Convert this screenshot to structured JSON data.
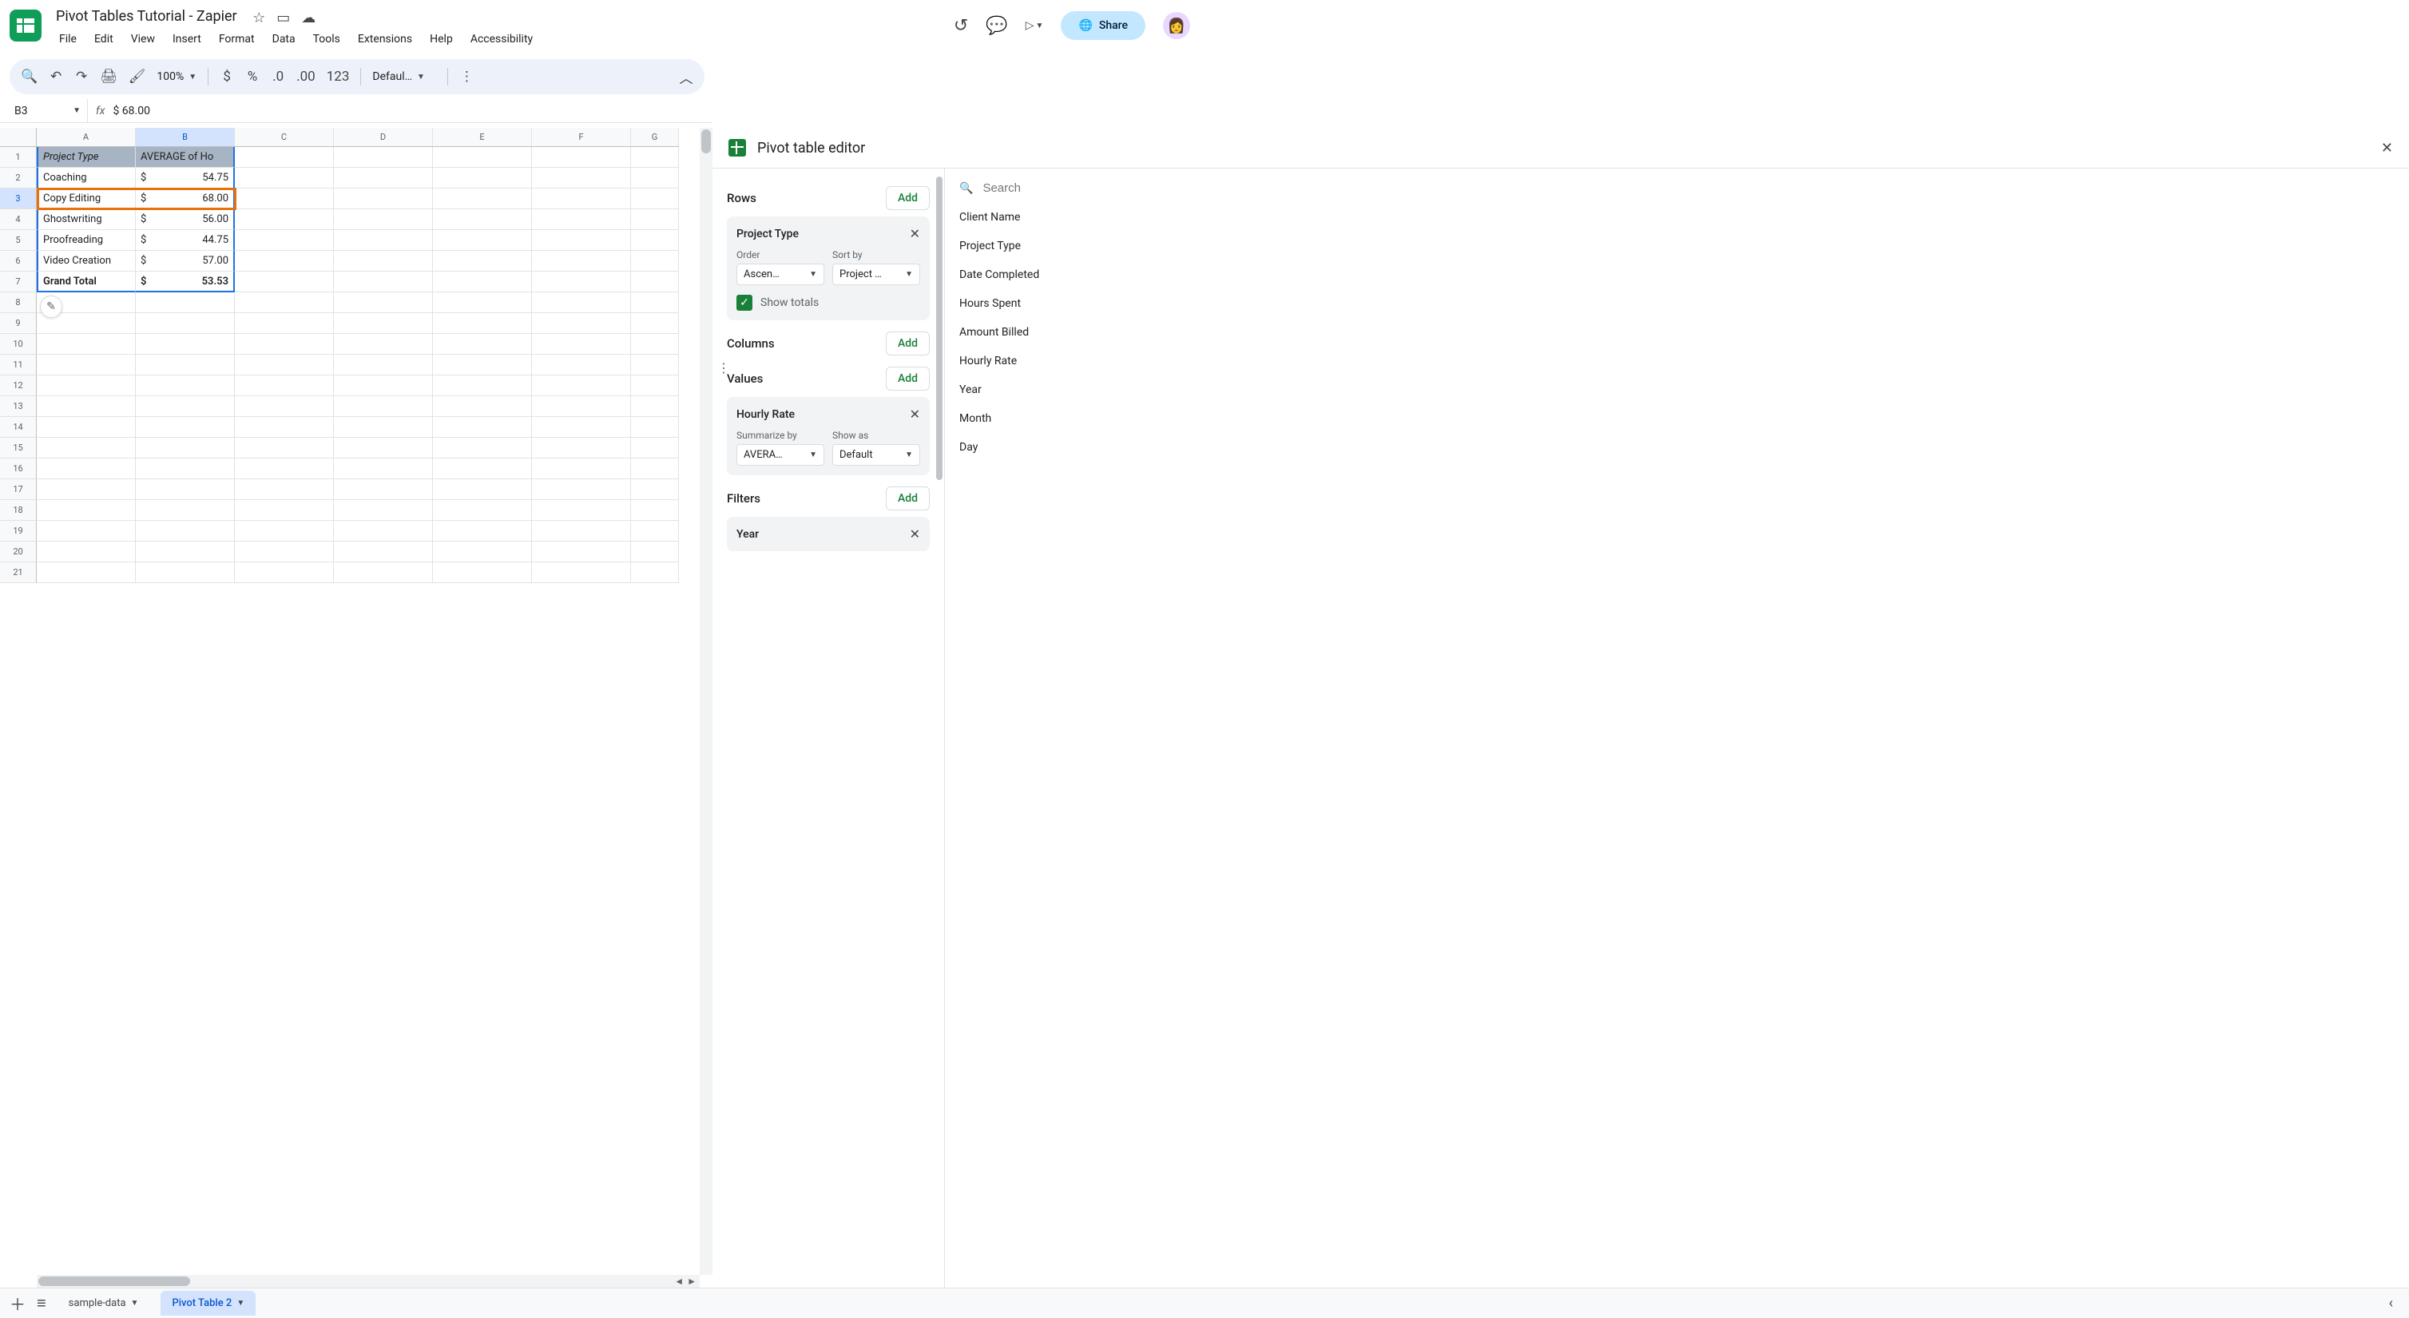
{
  "doc": {
    "title": "Pivot Tables Tutorial - Zapier"
  },
  "menubar": {
    "file": "File",
    "edit": "Edit",
    "view": "View",
    "insert": "Insert",
    "format": "Format",
    "data": "Data",
    "tools": "Tools",
    "extensions": "Extensions",
    "help": "Help",
    "accessibility": "Accessibility"
  },
  "toolbar": {
    "zoom": "100%",
    "currency": "$",
    "percent": "%",
    "dec_dec": ".0",
    "dec_inc": ".00",
    "num_fmt": "123",
    "font": "Defaul…"
  },
  "share_label": "Share",
  "namebox": "B3",
  "formula": "$ 68.00",
  "columns": {
    "A": "A",
    "B": "B",
    "C": "C",
    "D": "D",
    "E": "E",
    "F": "F",
    "G": "G"
  },
  "grid": {
    "header_A": "Project Type",
    "header_B": "AVERAGE of Ho",
    "rows": [
      {
        "label": "Coaching",
        "sym": "$",
        "val": "54.75"
      },
      {
        "label": "Copy Editing",
        "sym": "$",
        "val": "68.00"
      },
      {
        "label": "Ghostwriting",
        "sym": "$",
        "val": "56.00"
      },
      {
        "label": "Proofreading",
        "sym": "$",
        "val": "44.75"
      },
      {
        "label": "Video Creation",
        "sym": "$",
        "val": "57.00"
      }
    ],
    "total_label": "Grand Total",
    "total_sym": "$",
    "total_val": "53.53"
  },
  "sidebar": {
    "title": "Pivot table editor",
    "rows_label": "Rows",
    "add": "Add",
    "row_card": {
      "name": "Project Type",
      "order_label": "Order",
      "order_value": "Ascen…",
      "sort_label": "Sort by",
      "sort_value": "Project …",
      "show_totals": "Show totals"
    },
    "columns_label": "Columns",
    "values_label": "Values",
    "value_card": {
      "name": "Hourly Rate",
      "summ_label": "Summarize by",
      "summ_value": "AVERA…",
      "show_label": "Show as",
      "show_value": "Default"
    },
    "filters_label": "Filters",
    "filter_card": {
      "name": "Year"
    },
    "search_placeholder": "Search",
    "fields": [
      "Client Name",
      "Project Type",
      "Date Completed",
      "Hours Spent",
      "Amount Billed",
      "Hourly Rate",
      "Year",
      "Month",
      "Day"
    ]
  },
  "sheets": {
    "s1": "sample-data",
    "s2": "Pivot Table 2"
  }
}
